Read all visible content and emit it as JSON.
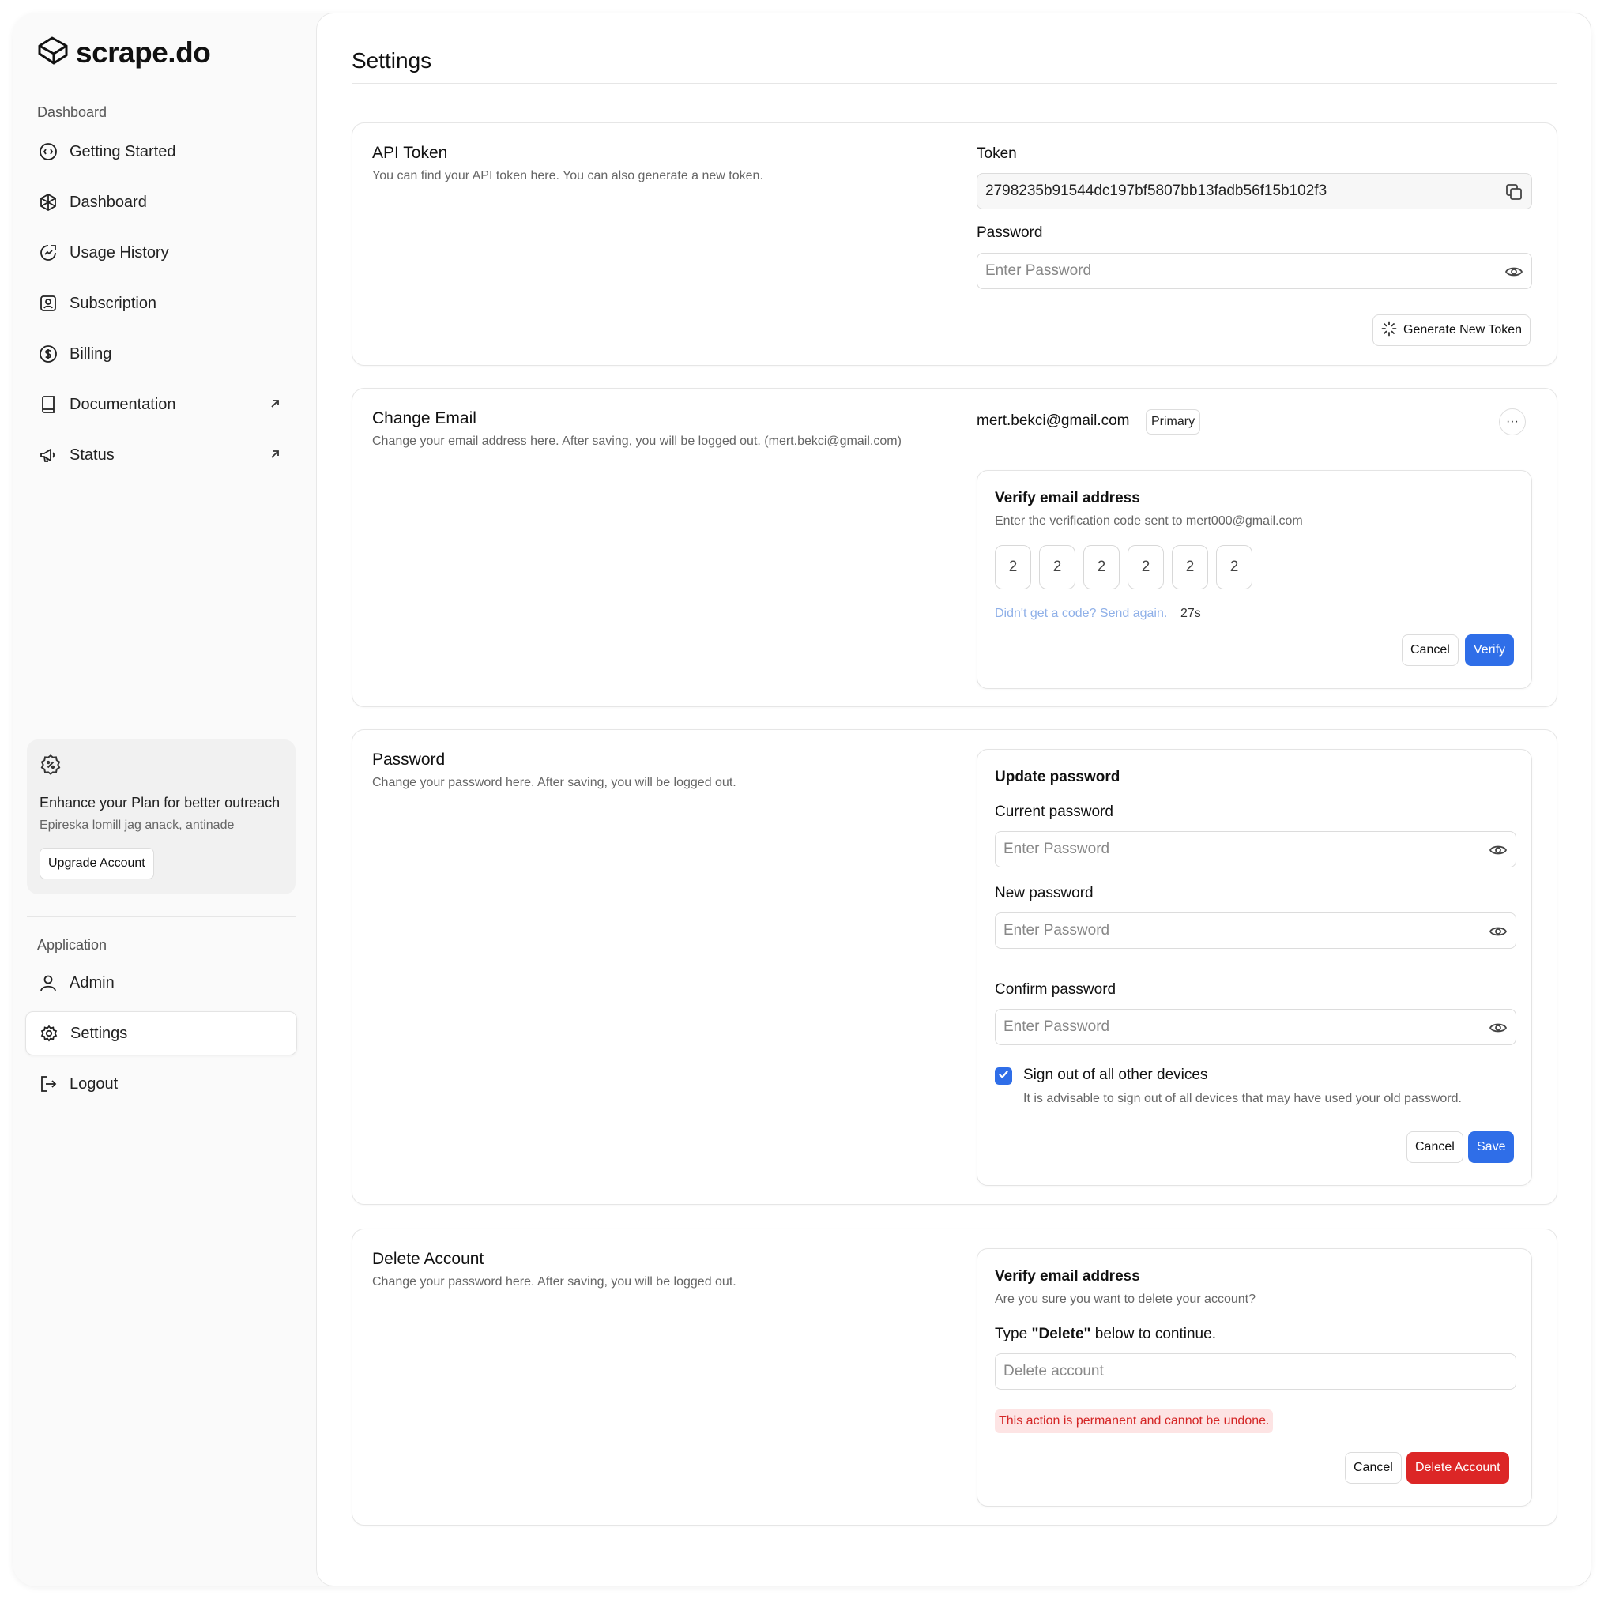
{
  "brand": {
    "name": "scrape.do"
  },
  "sidebar": {
    "section_dashboard": "Dashboard",
    "items": [
      {
        "label": "Getting Started",
        "icon": "getting-started-icon"
      },
      {
        "label": "Dashboard",
        "icon": "dashboard-icon"
      },
      {
        "label": "Usage History",
        "icon": "usage-history-icon"
      },
      {
        "label": "Subscription",
        "icon": "subscription-icon"
      },
      {
        "label": "Billing",
        "icon": "billing-icon"
      },
      {
        "label": "Documentation",
        "icon": "documentation-icon",
        "external": true
      },
      {
        "label": "Status",
        "icon": "status-icon",
        "external": true
      }
    ],
    "promo": {
      "title": "Enhance your Plan for better outreach",
      "subtitle": "Epireska lomill jag anack, antinade",
      "button": "Upgrade Account"
    },
    "section_application": "Application",
    "app_items": [
      {
        "label": "Admin",
        "icon": "user-icon"
      },
      {
        "label": "Settings",
        "icon": "gear-icon",
        "active": true
      },
      {
        "label": "Logout",
        "icon": "logout-icon"
      }
    ]
  },
  "main": {
    "title": "Settings",
    "api_token": {
      "title": "API Token",
      "description": "You can find your API token here. You can also generate a new token.",
      "token_label": "Token",
      "token_value": "2798235b91544dc197bf5807bb13fadb56f15b102f3",
      "password_label": "Password",
      "password_placeholder": "Enter Password",
      "generate_button": "Generate New Token"
    },
    "change_email": {
      "title": "Change Email",
      "description": "Change your email address here. After saving, you will be logged out. (mert.bekci@gmail.com)",
      "current_email": "mert.bekci@gmail.com",
      "badge": "Primary",
      "more": "···",
      "verify": {
        "title": "Verify email address",
        "subtitle": "Enter the verification code sent to mert000@gmail.com",
        "code": [
          "2",
          "2",
          "2",
          "2",
          "2",
          "2"
        ],
        "resend": "Didn't get a code? Send again.",
        "timer": "27s",
        "cancel": "Cancel",
        "submit": "Verify"
      }
    },
    "password": {
      "title": "Password",
      "description": "Change your password here. After saving, you will be logged out.",
      "panel_title": "Update password",
      "current_label": "Current password",
      "new_label": "New password",
      "confirm_label": "Confirm password",
      "placeholder": "Enter Password",
      "signout_label": "Sign out of all other devices",
      "signout_hint": "It is advisable to sign out of all devices that may have used your old password.",
      "signout_checked": true,
      "cancel": "Cancel",
      "save": "Save"
    },
    "delete_account": {
      "title": "Delete Account",
      "description": "Change your password here. After saving, you will be logged out.",
      "panel_title": "Verify email address",
      "panel_subtitle": "Are you sure you want to delete your account?",
      "prompt_prefix": "Type ",
      "prompt_keyword": "\"Delete\"",
      "prompt_suffix": " below to continue.",
      "input_placeholder": "Delete account",
      "warning": "This action is permanent and cannot be undone.",
      "cancel": "Cancel",
      "submit": "Delete Account"
    }
  },
  "colors": {
    "accent": "#2f6ee8",
    "danger": "#dc2626",
    "warning_bg": "#fde4e4",
    "link": "#8fb0e8"
  }
}
